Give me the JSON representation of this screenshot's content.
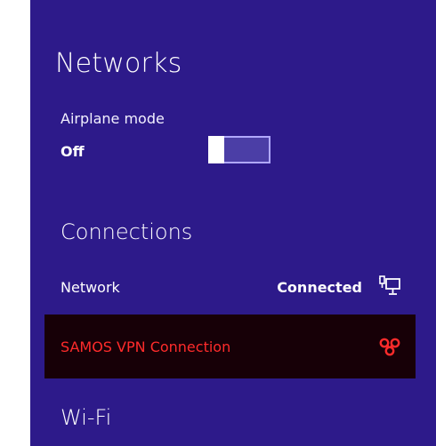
{
  "panel": {
    "title": "Networks",
    "airplane_mode": {
      "label": "Airplane mode",
      "state": "Off",
      "enabled": false
    },
    "connections": {
      "header": "Connections",
      "items": [
        {
          "name": "Network",
          "status": "Connected",
          "icon": "wired-network-icon"
        },
        {
          "name": "SAMOS VPN Connection",
          "status": "",
          "icon": "vpn-icon"
        }
      ]
    },
    "wifi": {
      "header": "Wi-Fi"
    }
  },
  "colors": {
    "panel_bg": "#2d1a8a",
    "vpn_row_bg": "#170007",
    "vpn_text": "#ff2b2b"
  }
}
